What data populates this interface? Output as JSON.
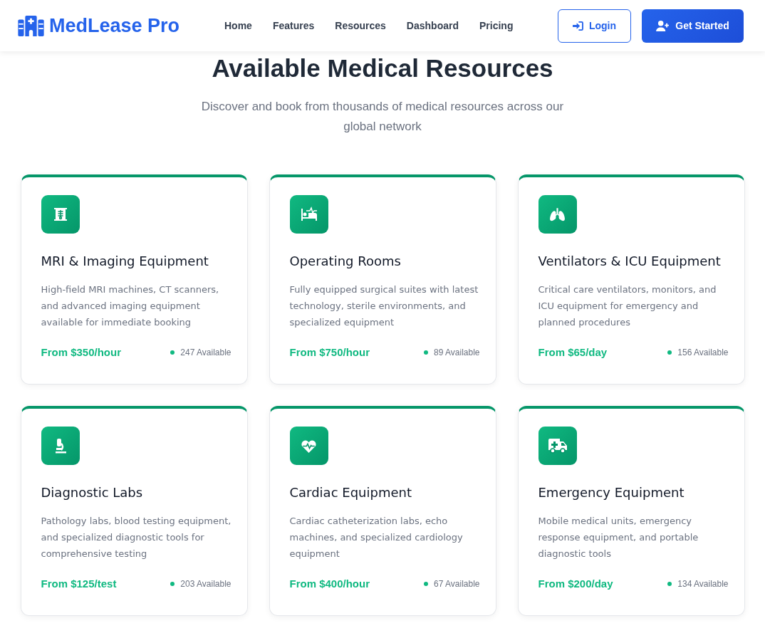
{
  "header": {
    "logo": "MedLease Pro",
    "nav": [
      "Home",
      "Features",
      "Resources",
      "Dashboard",
      "Pricing"
    ],
    "login_button": "Login",
    "get_started_button": "Get Started"
  },
  "section": {
    "title": "Available Medical Resources",
    "subtitle": "Discover and book from thousands of medical resources across our global network"
  },
  "cards": [
    {
      "title": "MRI & Imaging Equipment",
      "description": "High-field MRI machines, CT scanners, and advanced imaging equipment available for immediate booking",
      "price": "From $350/hour",
      "availability": "247 Available"
    },
    {
      "title": "Operating Rooms",
      "description": "Fully equipped surgical suites with latest technology, sterile environments, and specialized equipment",
      "price": "From $750/hour",
      "availability": "89 Available"
    },
    {
      "title": "Ventilators & ICU Equipment",
      "description": "Critical care ventilators, monitors, and ICU equipment for emergency and planned procedures",
      "price": "From $65/day",
      "availability": "156 Available"
    },
    {
      "title": "Diagnostic Labs",
      "description": "Pathology labs, blood testing equipment, and specialized diagnostic tools for comprehensive testing",
      "price": "From $125/test",
      "availability": "203 Available"
    },
    {
      "title": "Cardiac Equipment",
      "description": "Cardiac catheterization labs, echo machines, and specialized cardiology equipment",
      "price": "From $400/hour",
      "availability": "67 Available"
    },
    {
      "title": "Emergency Equipment",
      "description": "Mobile medical units, emergency response equipment, and portable diagnostic tools",
      "price": "From $200/day",
      "availability": "134 Available"
    }
  ]
}
